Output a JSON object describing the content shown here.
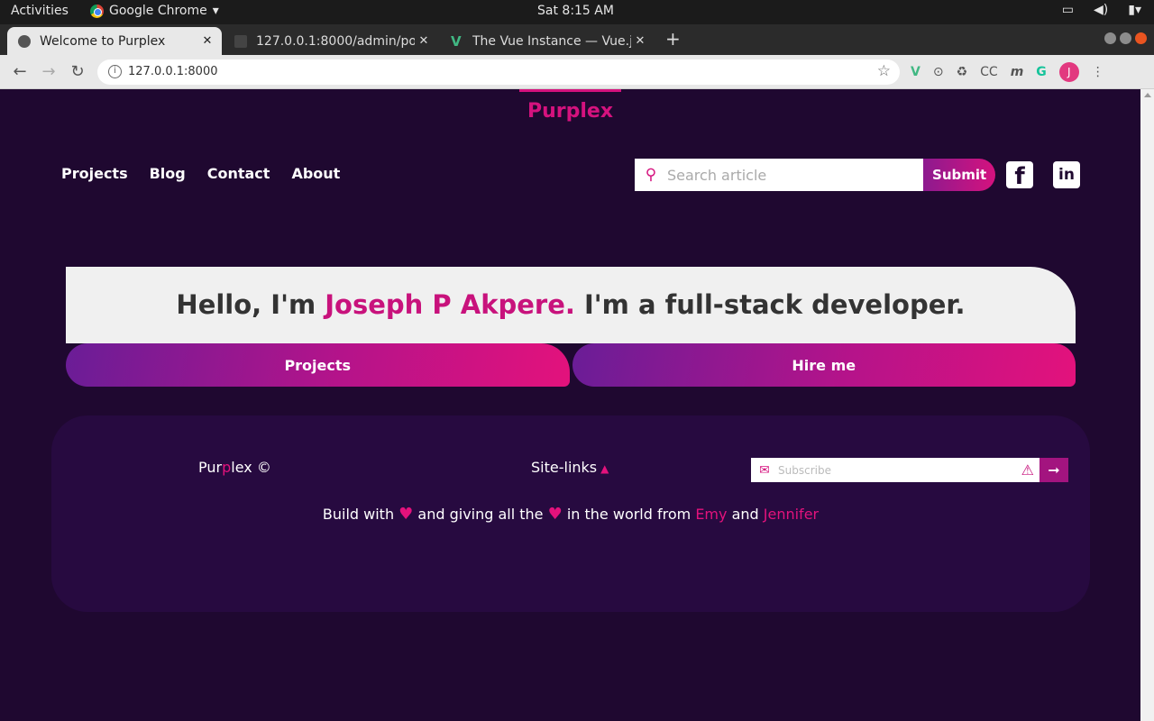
{
  "system_bar": {
    "activities": "Activities",
    "app_name": "Google Chrome",
    "clock": "Sat  8:15 AM"
  },
  "tabs": [
    {
      "title": "Welcome to Purplex",
      "active": true,
      "favicon": "globe-icon"
    },
    {
      "title": "127.0.0.1:8000/admin/pos",
      "active": false,
      "favicon": "site-icon"
    },
    {
      "title": "The Vue Instance — Vue.js",
      "active": false,
      "favicon": "vue-icon"
    }
  ],
  "address_bar": {
    "url": "127.0.0.1:8000",
    "profile_initial": "J"
  },
  "site": {
    "brand": "Purplex",
    "nav": [
      "Projects",
      "Blog",
      "Contact",
      "About"
    ],
    "search": {
      "placeholder": "Search article",
      "submit_label": "Submit"
    },
    "hero": {
      "greeting": "Hello, I'm ",
      "name": "Joseph P Akpere.",
      "tagline": " I'm a full-stack developer.",
      "buttons": [
        "Projects",
        "Hire me"
      ]
    },
    "footer": {
      "copyright_a": "Pur",
      "copyright_b": "p",
      "copyright_c": "lex ©",
      "site_links": "Site-links",
      "subscribe_placeholder": "Subscribe",
      "credits_1": "Build with ",
      "credits_2": " and giving all the ",
      "credits_3": " in the world from ",
      "author_1": "Emy",
      "credits_and": " and ",
      "author_2": "Jennifer"
    }
  },
  "colors": {
    "accent": "#d5127e",
    "background": "#1f0830",
    "footer_bg": "#270a40"
  }
}
